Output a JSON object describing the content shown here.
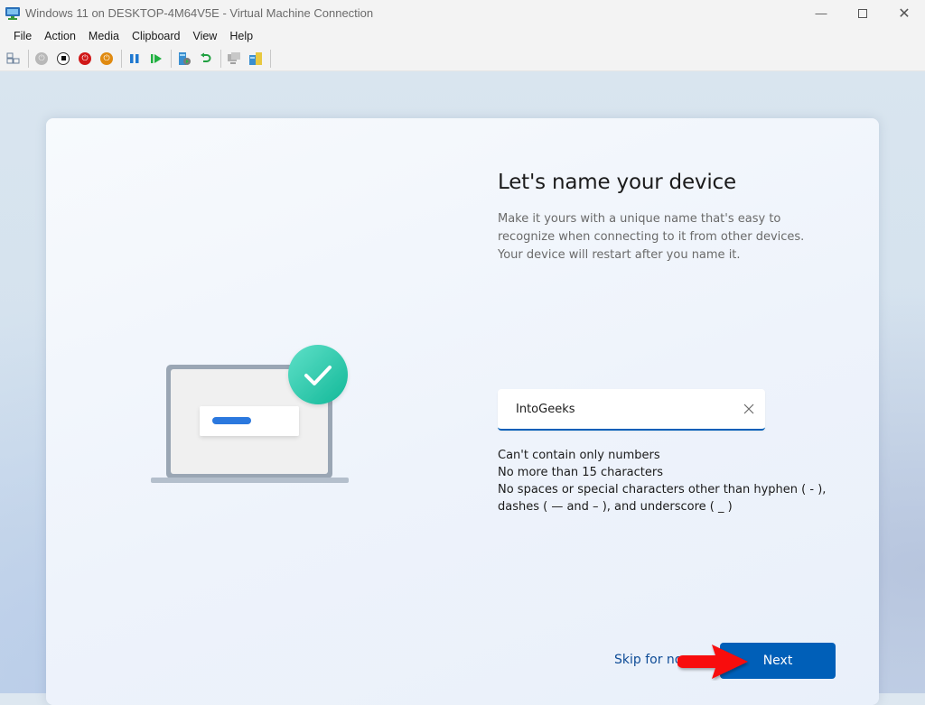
{
  "window": {
    "title": "Windows 11 on DESKTOP-4M64V5E - Virtual Machine Connection",
    "controls": [
      "minimize",
      "maximize",
      "close"
    ]
  },
  "menu": [
    "File",
    "Action",
    "Media",
    "Clipboard",
    "View",
    "Help"
  ],
  "toolbar": {
    "icons": [
      "ctrl-alt-del-icon",
      "start-icon",
      "turn-off-icon",
      "shutdown-icon",
      "save-icon",
      "pause-icon",
      "reset-icon",
      "checkpoint-icon",
      "revert-icon",
      "enhanced-session-icon",
      "share-icon"
    ]
  },
  "oobe": {
    "heading": "Let's name your device",
    "description": "Make it yours with a unique name that's easy to recognize when connecting to it from other devices. Your device will restart after you name it.",
    "device_name": {
      "value": "IntoGeeks",
      "placeholder": ""
    },
    "rules": [
      "Can't contain only numbers",
      "No more than 15 characters",
      "No spaces or special characters other than hyphen ( - ),",
      "dashes ( — and – ), and underscore ( _ )"
    ],
    "skip_label": "Skip for now",
    "next_label": "Next"
  },
  "colors": {
    "accent": "#005fb8",
    "check_badge": "#1fc3a5",
    "annotation_arrow": "#ff0000"
  }
}
